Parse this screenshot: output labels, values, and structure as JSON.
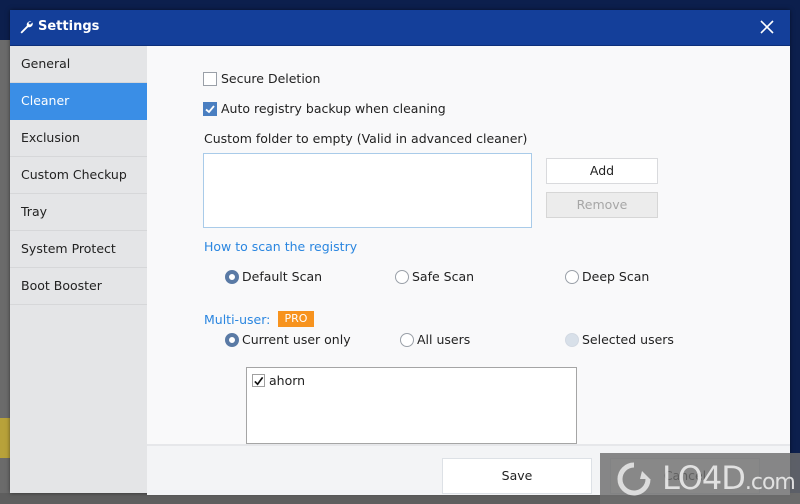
{
  "window": {
    "title": "Settings",
    "title_icon": "wrench-icon",
    "close_icon": "close-icon"
  },
  "sidebar": {
    "items": [
      {
        "label": "General",
        "active": false
      },
      {
        "label": "Cleaner",
        "active": true
      },
      {
        "label": "Exclusion",
        "active": false
      },
      {
        "label": "Custom Checkup",
        "active": false
      },
      {
        "label": "Tray",
        "active": false
      },
      {
        "label": "System Protect",
        "active": false
      },
      {
        "label": "Boot Booster",
        "active": false
      }
    ]
  },
  "cleaner": {
    "secure_deletion": {
      "label": "Secure Deletion",
      "checked": false
    },
    "auto_backup": {
      "label": "Auto registry backup when cleaning",
      "checked": true
    },
    "custom_folder_label": "Custom folder to empty (Valid in advanced cleaner)",
    "custom_folder_value": "",
    "add_label": "Add",
    "remove_label": "Remove",
    "scan_heading": "How to scan the registry",
    "scan_options": [
      {
        "label": "Default Scan",
        "selected": true
      },
      {
        "label": "Safe Scan",
        "selected": false
      },
      {
        "label": "Deep Scan",
        "selected": false
      }
    ],
    "multiuser_heading": "Multi-user:",
    "pro_badge": "PRO",
    "user_options": [
      {
        "label": "Current user only",
        "selected": true
      },
      {
        "label": "All users",
        "selected": false
      },
      {
        "label": "Selected users",
        "selected": false,
        "disabled": true
      }
    ],
    "users": [
      {
        "name": "ahorn",
        "checked": true
      }
    ]
  },
  "footer": {
    "save_label": "Save",
    "cancel_label": "Cancel"
  },
  "watermark": {
    "text": "LO4D",
    "suffix": ".com"
  },
  "colors": {
    "titlebar": "#143f9a",
    "accent": "#3a8ee6",
    "link": "#2a86e0",
    "pro": "#f7931e"
  }
}
